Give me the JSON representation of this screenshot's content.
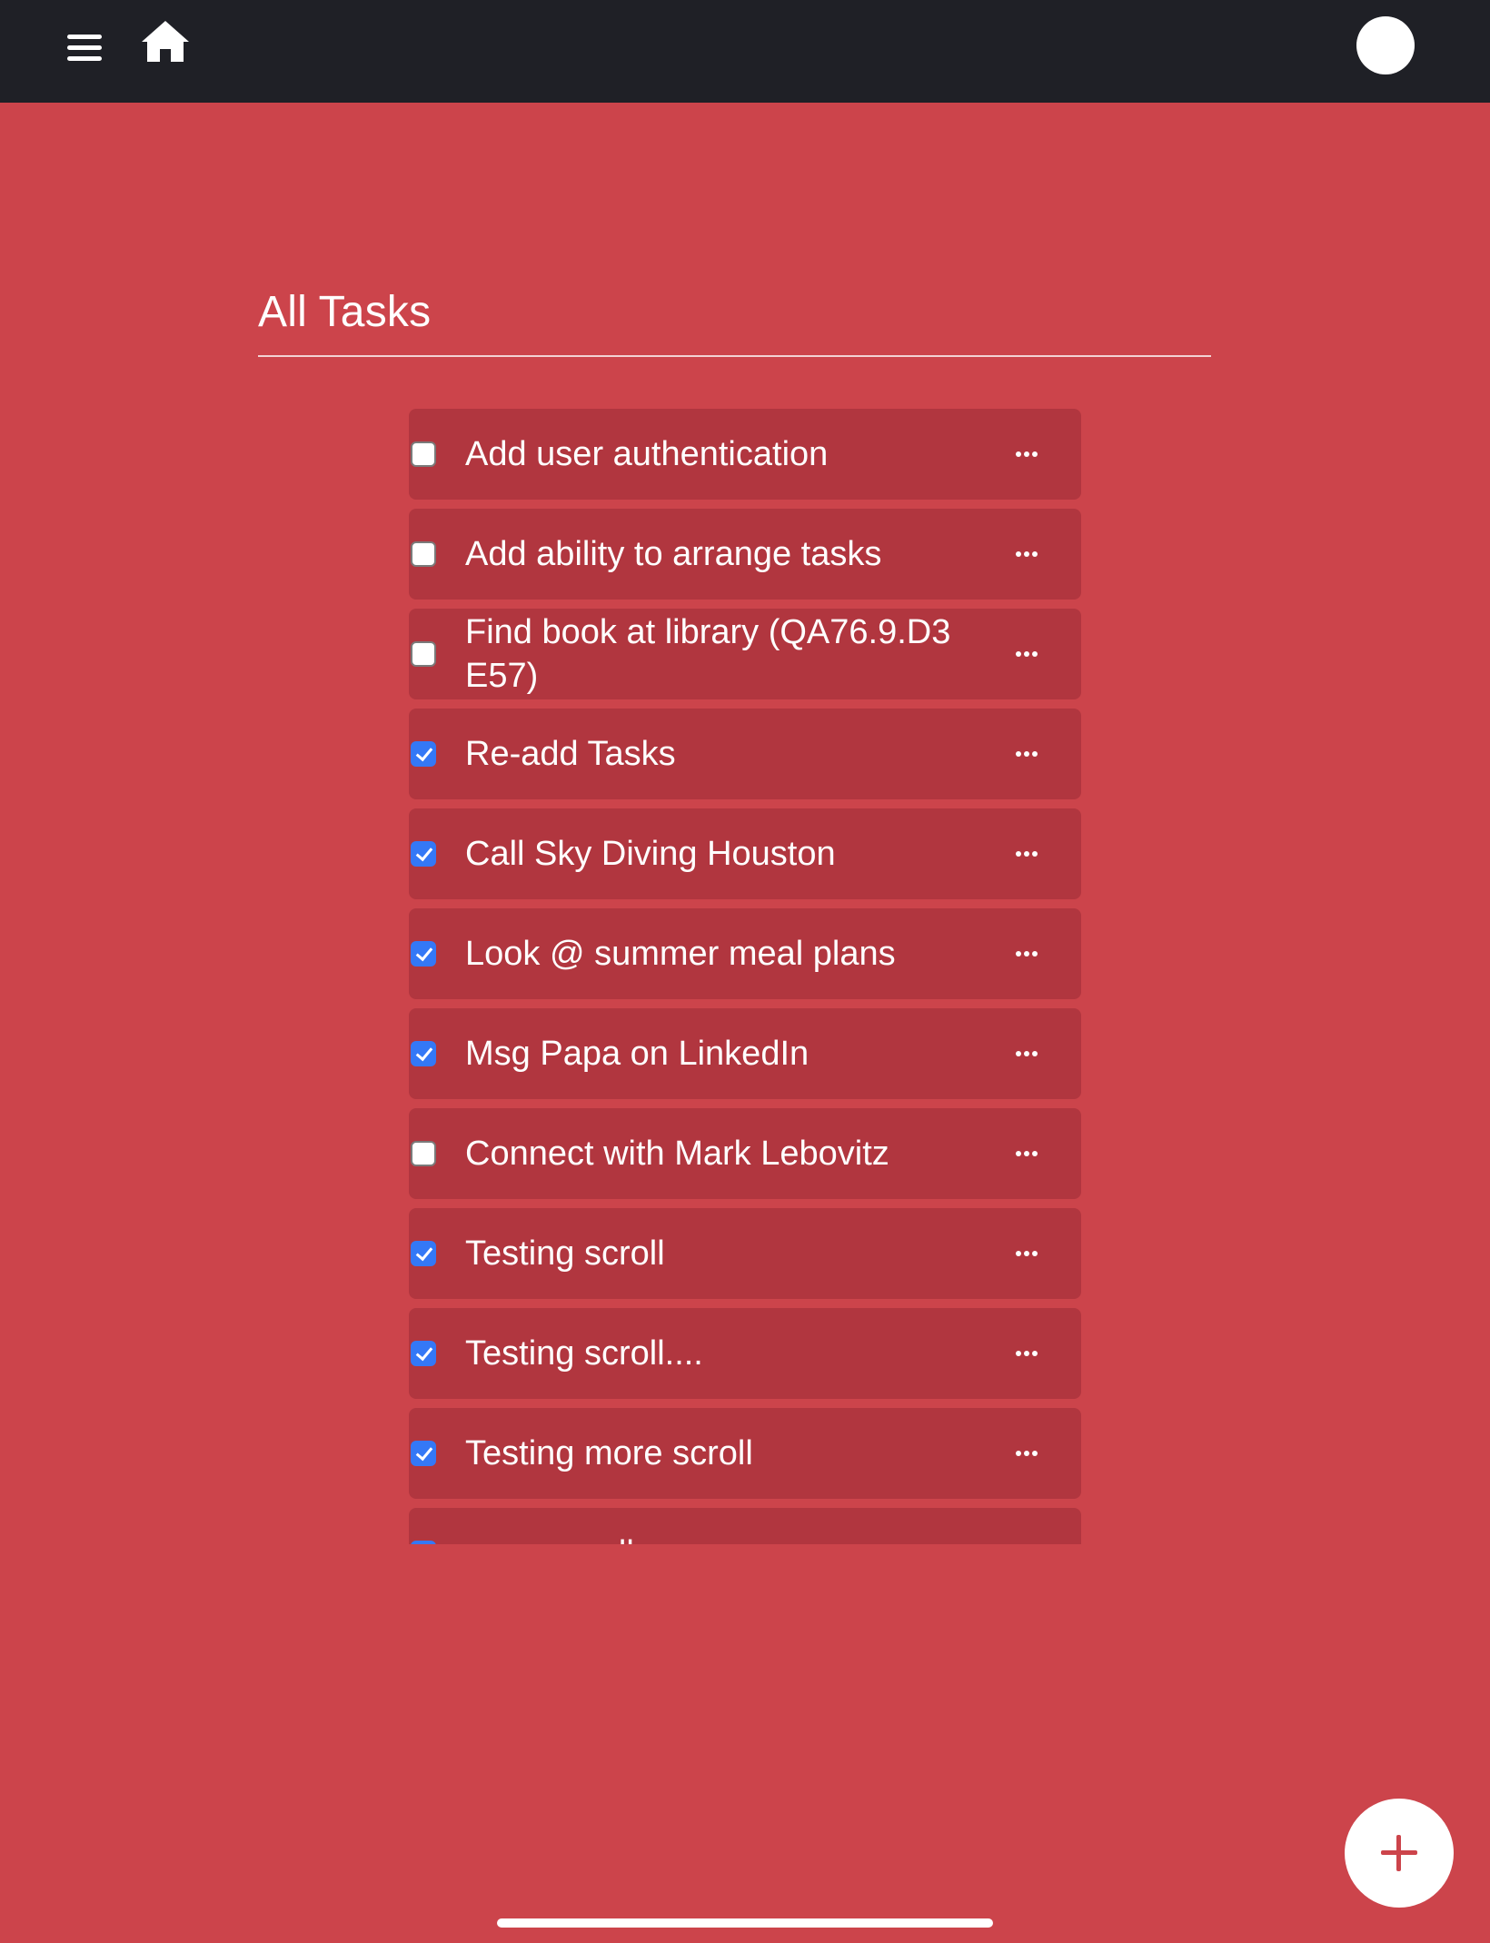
{
  "header": {
    "menu_icon": "hamburger-menu-icon",
    "home_icon": "home-icon",
    "avatar_icon": "user-avatar"
  },
  "page": {
    "title": "All Tasks"
  },
  "tasks": [
    {
      "label": "Add user authentication",
      "checked": false
    },
    {
      "label": "Add ability to arrange tasks",
      "checked": false
    },
    {
      "label": "Find book at library (QA76.9.D3 E57)",
      "checked": false
    },
    {
      "label": "Re-add Tasks",
      "checked": true
    },
    {
      "label": "Call Sky Diving Houston",
      "checked": true
    },
    {
      "label": "Look @ summer meal plans",
      "checked": true
    },
    {
      "label": "Msg Papa on LinkedIn",
      "checked": true
    },
    {
      "label": "Connect with Mark Lebovitz",
      "checked": false
    },
    {
      "label": "Testing scroll",
      "checked": true
    },
    {
      "label": "Testing scroll....",
      "checked": true
    },
    {
      "label": "Testing more scroll",
      "checked": true
    },
    {
      "label": "more scroll",
      "checked": true
    }
  ],
  "task_menu_icon": "more-horizontal-icon",
  "fab": {
    "icon": "plus-icon"
  },
  "colors": {
    "background": "#cc444b",
    "header": "#1f2026",
    "task_card": "#b1363f",
    "checkbox_checked": "#3478f6",
    "text": "#ffffff"
  }
}
